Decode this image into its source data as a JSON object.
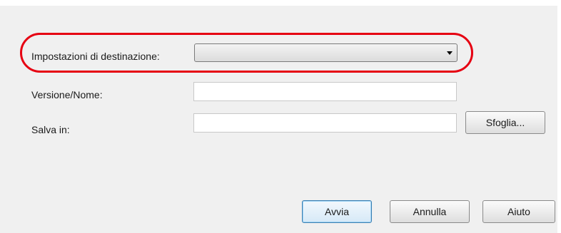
{
  "form": {
    "destination_label": "Impostazioni di destinazione:",
    "destination_value": "",
    "version_label": "Versione/Nome:",
    "version_value": "",
    "save_label": "Salva in:",
    "save_value": ""
  },
  "buttons": {
    "browse": "Sfoglia...",
    "start": "Avvia",
    "cancel": "Annulla",
    "help": "Aiuto"
  },
  "colors": {
    "highlight": "#e60012",
    "dialog_background": "#f0f0f0"
  },
  "icons": {
    "dropdown": "chevron-down-icon"
  }
}
